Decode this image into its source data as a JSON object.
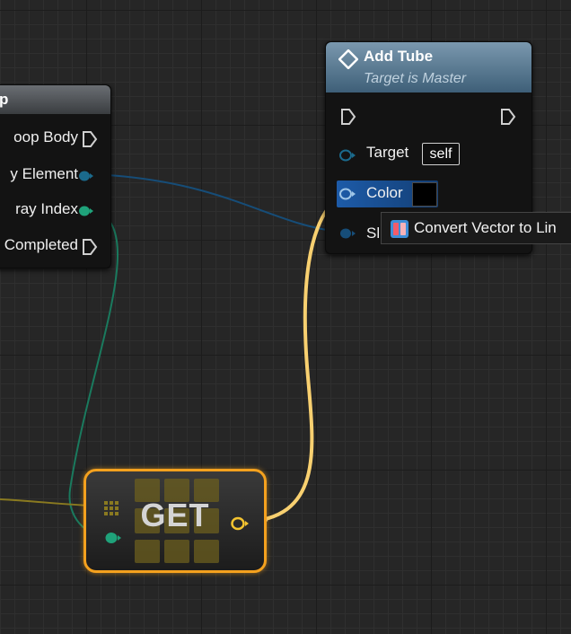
{
  "colors": {
    "exec": "#d0d0d0",
    "wildcard": "#1b6a8c",
    "integer": "#1fa27a",
    "linear_color": "#164d78",
    "wire_orange": "#f8d070",
    "accent": "#f4a11e"
  },
  "loop_node": {
    "title": "p",
    "pins": {
      "loop_body": "oop Body",
      "array_element": "y Element",
      "array_index": "ray Index",
      "completed": "Completed"
    }
  },
  "add_tube_node": {
    "title": "Add Tube",
    "subtitle": "Target is Master",
    "icon": "function-icon",
    "pins": {
      "target_label": "Target",
      "target_value": "self",
      "color_label": "Color",
      "sl_label": "Sl"
    }
  },
  "tooltip": {
    "icon": "conversion-icon",
    "text": "Convert Vector to Lin"
  },
  "get_node": {
    "label": "GET",
    "icon": "array-grid-icon"
  }
}
